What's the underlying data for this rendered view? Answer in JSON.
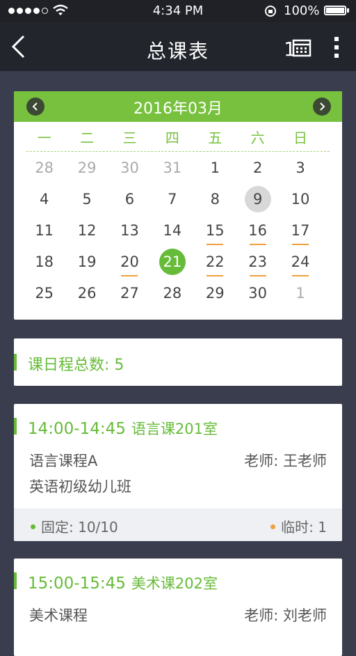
{
  "status_bar": {
    "time": "4:34 PM",
    "battery": "100%"
  },
  "nav": {
    "title": "总课表",
    "calendar_icon_text": "1"
  },
  "calendar": {
    "month": "2016年03月",
    "weekdays": [
      "一",
      "二",
      "三",
      "四",
      "五",
      "六",
      "日"
    ],
    "weeks": [
      [
        {
          "d": "28",
          "m": true
        },
        {
          "d": "29",
          "m": true
        },
        {
          "d": "30",
          "m": true
        },
        {
          "d": "31",
          "m": true
        },
        {
          "d": "1"
        },
        {
          "d": "2"
        },
        {
          "d": "3"
        }
      ],
      [
        {
          "d": "4"
        },
        {
          "d": "5"
        },
        {
          "d": "6"
        },
        {
          "d": "7"
        },
        {
          "d": "8"
        },
        {
          "d": "9",
          "today": true
        },
        {
          "d": "10"
        }
      ],
      [
        {
          "d": "11"
        },
        {
          "d": "12"
        },
        {
          "d": "13"
        },
        {
          "d": "14"
        },
        {
          "d": "15",
          "ev": true
        },
        {
          "d": "16",
          "ev": true
        },
        {
          "d": "17",
          "ev": true
        }
      ],
      [
        {
          "d": "18"
        },
        {
          "d": "19"
        },
        {
          "d": "20",
          "ev": true
        },
        {
          "d": "21",
          "sel": true
        },
        {
          "d": "22",
          "ev": true
        },
        {
          "d": "23",
          "ev": true
        },
        {
          "d": "24",
          "ev": true
        }
      ],
      [
        {
          "d": "25"
        },
        {
          "d": "26"
        },
        {
          "d": "27"
        },
        {
          "d": "28"
        },
        {
          "d": "29"
        },
        {
          "d": "30"
        },
        {
          "d": "1",
          "m": true
        }
      ]
    ]
  },
  "summary": {
    "text": "课日程总数: 5"
  },
  "lessons": [
    {
      "time": "14:00-14:45",
      "room": "语言课201室",
      "course": "语言课程A",
      "teacher": "老师: 王老师",
      "class": "英语初级幼儿班",
      "fixed": "固定: 10/10",
      "temp": "临时: 1"
    },
    {
      "time": "15:00-15:45",
      "room": "美术课202室",
      "course": "美术课程",
      "teacher": "老师: 刘老师"
    }
  ],
  "colors": {
    "accent": "#66bb38",
    "header_green": "#78c13f",
    "event_underline": "#f0a040",
    "nav_bg": "#22252c",
    "page_bg": "#3a3d4d"
  }
}
